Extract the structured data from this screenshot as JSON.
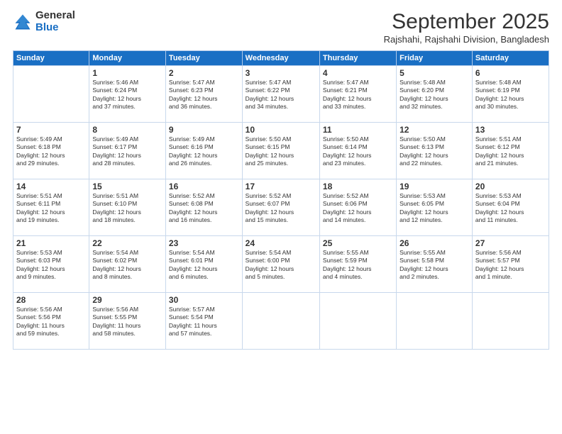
{
  "logo": {
    "general": "General",
    "blue": "Blue"
  },
  "header": {
    "month": "September 2025",
    "location": "Rajshahi, Rajshahi Division, Bangladesh"
  },
  "weekdays": [
    "Sunday",
    "Monday",
    "Tuesday",
    "Wednesday",
    "Thursday",
    "Friday",
    "Saturday"
  ],
  "weeks": [
    [
      {
        "day": "",
        "info": ""
      },
      {
        "day": "1",
        "info": "Sunrise: 5:46 AM\nSunset: 6:24 PM\nDaylight: 12 hours\nand 37 minutes."
      },
      {
        "day": "2",
        "info": "Sunrise: 5:47 AM\nSunset: 6:23 PM\nDaylight: 12 hours\nand 36 minutes."
      },
      {
        "day": "3",
        "info": "Sunrise: 5:47 AM\nSunset: 6:22 PM\nDaylight: 12 hours\nand 34 minutes."
      },
      {
        "day": "4",
        "info": "Sunrise: 5:47 AM\nSunset: 6:21 PM\nDaylight: 12 hours\nand 33 minutes."
      },
      {
        "day": "5",
        "info": "Sunrise: 5:48 AM\nSunset: 6:20 PM\nDaylight: 12 hours\nand 32 minutes."
      },
      {
        "day": "6",
        "info": "Sunrise: 5:48 AM\nSunset: 6:19 PM\nDaylight: 12 hours\nand 30 minutes."
      }
    ],
    [
      {
        "day": "7",
        "info": "Sunrise: 5:49 AM\nSunset: 6:18 PM\nDaylight: 12 hours\nand 29 minutes."
      },
      {
        "day": "8",
        "info": "Sunrise: 5:49 AM\nSunset: 6:17 PM\nDaylight: 12 hours\nand 28 minutes."
      },
      {
        "day": "9",
        "info": "Sunrise: 5:49 AM\nSunset: 6:16 PM\nDaylight: 12 hours\nand 26 minutes."
      },
      {
        "day": "10",
        "info": "Sunrise: 5:50 AM\nSunset: 6:15 PM\nDaylight: 12 hours\nand 25 minutes."
      },
      {
        "day": "11",
        "info": "Sunrise: 5:50 AM\nSunset: 6:14 PM\nDaylight: 12 hours\nand 23 minutes."
      },
      {
        "day": "12",
        "info": "Sunrise: 5:50 AM\nSunset: 6:13 PM\nDaylight: 12 hours\nand 22 minutes."
      },
      {
        "day": "13",
        "info": "Sunrise: 5:51 AM\nSunset: 6:12 PM\nDaylight: 12 hours\nand 21 minutes."
      }
    ],
    [
      {
        "day": "14",
        "info": "Sunrise: 5:51 AM\nSunset: 6:11 PM\nDaylight: 12 hours\nand 19 minutes."
      },
      {
        "day": "15",
        "info": "Sunrise: 5:51 AM\nSunset: 6:10 PM\nDaylight: 12 hours\nand 18 minutes."
      },
      {
        "day": "16",
        "info": "Sunrise: 5:52 AM\nSunset: 6:08 PM\nDaylight: 12 hours\nand 16 minutes."
      },
      {
        "day": "17",
        "info": "Sunrise: 5:52 AM\nSunset: 6:07 PM\nDaylight: 12 hours\nand 15 minutes."
      },
      {
        "day": "18",
        "info": "Sunrise: 5:52 AM\nSunset: 6:06 PM\nDaylight: 12 hours\nand 14 minutes."
      },
      {
        "day": "19",
        "info": "Sunrise: 5:53 AM\nSunset: 6:05 PM\nDaylight: 12 hours\nand 12 minutes."
      },
      {
        "day": "20",
        "info": "Sunrise: 5:53 AM\nSunset: 6:04 PM\nDaylight: 12 hours\nand 11 minutes."
      }
    ],
    [
      {
        "day": "21",
        "info": "Sunrise: 5:53 AM\nSunset: 6:03 PM\nDaylight: 12 hours\nand 9 minutes."
      },
      {
        "day": "22",
        "info": "Sunrise: 5:54 AM\nSunset: 6:02 PM\nDaylight: 12 hours\nand 8 minutes."
      },
      {
        "day": "23",
        "info": "Sunrise: 5:54 AM\nSunset: 6:01 PM\nDaylight: 12 hours\nand 6 minutes."
      },
      {
        "day": "24",
        "info": "Sunrise: 5:54 AM\nSunset: 6:00 PM\nDaylight: 12 hours\nand 5 minutes."
      },
      {
        "day": "25",
        "info": "Sunrise: 5:55 AM\nSunset: 5:59 PM\nDaylight: 12 hours\nand 4 minutes."
      },
      {
        "day": "26",
        "info": "Sunrise: 5:55 AM\nSunset: 5:58 PM\nDaylight: 12 hours\nand 2 minutes."
      },
      {
        "day": "27",
        "info": "Sunrise: 5:56 AM\nSunset: 5:57 PM\nDaylight: 12 hours\nand 1 minute."
      }
    ],
    [
      {
        "day": "28",
        "info": "Sunrise: 5:56 AM\nSunset: 5:56 PM\nDaylight: 11 hours\nand 59 minutes."
      },
      {
        "day": "29",
        "info": "Sunrise: 5:56 AM\nSunset: 5:55 PM\nDaylight: 11 hours\nand 58 minutes."
      },
      {
        "day": "30",
        "info": "Sunrise: 5:57 AM\nSunset: 5:54 PM\nDaylight: 11 hours\nand 57 minutes."
      },
      {
        "day": "",
        "info": ""
      },
      {
        "day": "",
        "info": ""
      },
      {
        "day": "",
        "info": ""
      },
      {
        "day": "",
        "info": ""
      }
    ]
  ]
}
